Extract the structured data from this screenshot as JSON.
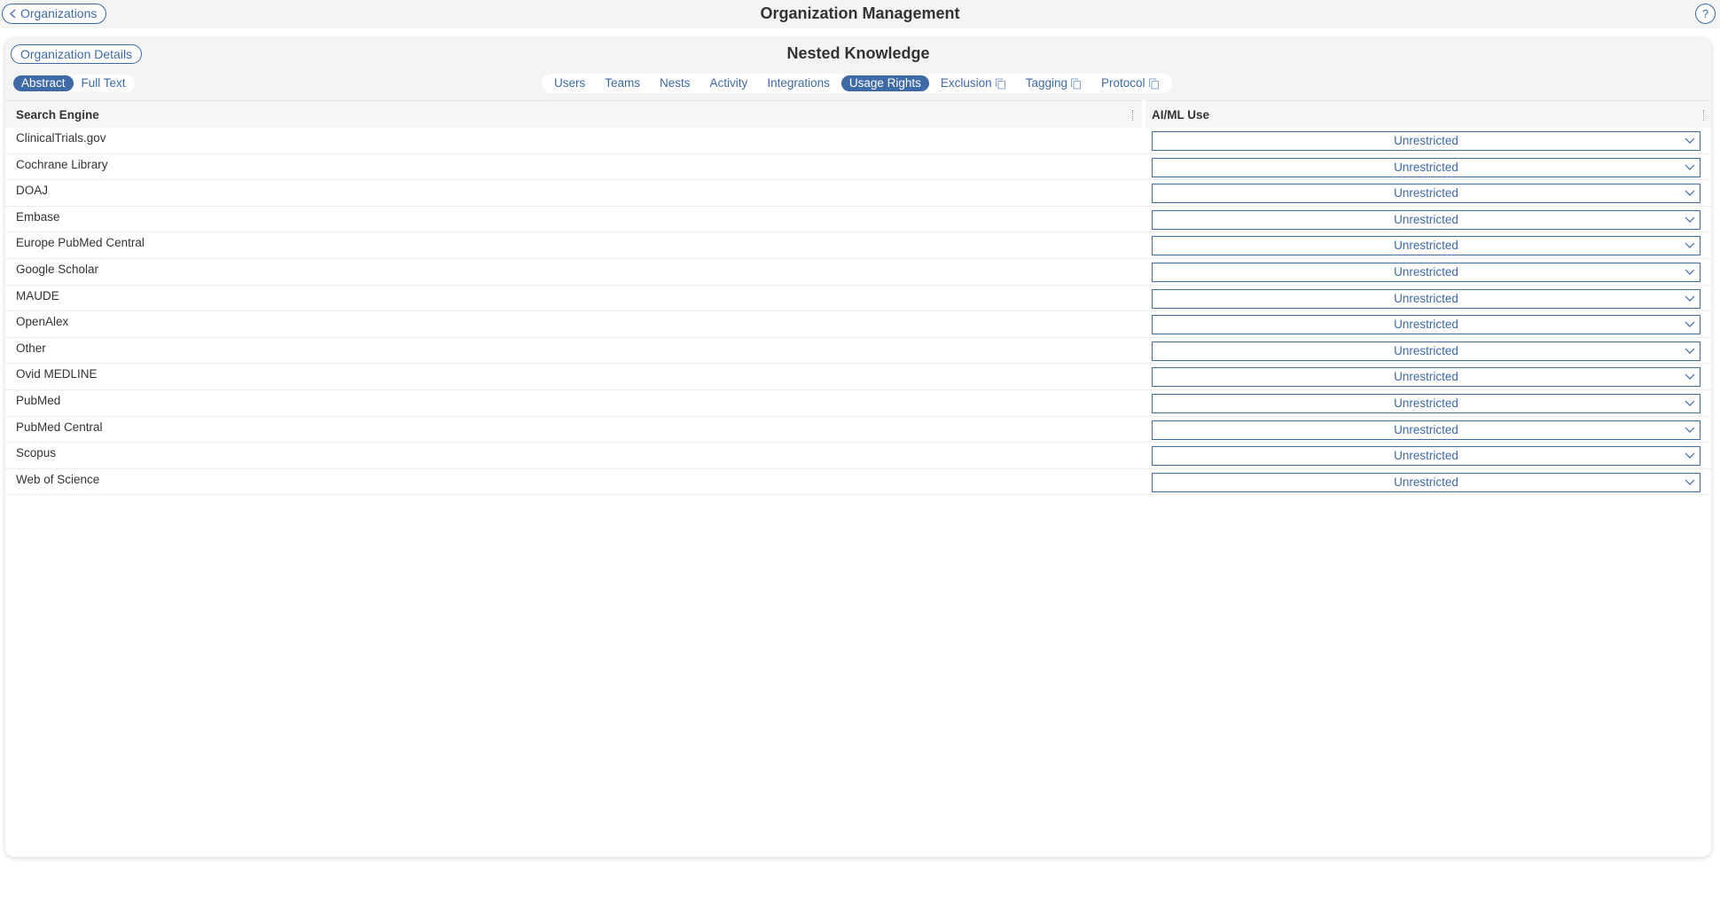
{
  "topbar": {
    "back_label": "Organizations",
    "title": "Organization Management",
    "help_label": "?"
  },
  "panel": {
    "details_button": "Organization Details",
    "title": "Nested Knowledge",
    "modes": [
      {
        "label": "Abstract",
        "active": true
      },
      {
        "label": "Full Text",
        "active": false
      }
    ],
    "tabs": [
      {
        "label": "Users",
        "active": false,
        "copy_icon": false
      },
      {
        "label": "Teams",
        "active": false,
        "copy_icon": false
      },
      {
        "label": "Nests",
        "active": false,
        "copy_icon": false
      },
      {
        "label": "Activity",
        "active": false,
        "copy_icon": false
      },
      {
        "label": "Integrations",
        "active": false,
        "copy_icon": false
      },
      {
        "label": "Usage Rights",
        "active": true,
        "copy_icon": false
      },
      {
        "label": "Exclusion",
        "active": false,
        "copy_icon": true
      },
      {
        "label": "Tagging",
        "active": false,
        "copy_icon": true
      },
      {
        "label": "Protocol",
        "active": false,
        "copy_icon": true
      }
    ]
  },
  "table": {
    "columns": [
      "Search Engine",
      "AI/ML Use"
    ],
    "rows": [
      {
        "engine": "ClinicalTrials.gov",
        "use": "Unrestricted"
      },
      {
        "engine": "Cochrane Library",
        "use": "Unrestricted"
      },
      {
        "engine": "DOAJ",
        "use": "Unrestricted"
      },
      {
        "engine": "Embase",
        "use": "Unrestricted"
      },
      {
        "engine": "Europe PubMed Central",
        "use": "Unrestricted"
      },
      {
        "engine": "Google Scholar",
        "use": "Unrestricted"
      },
      {
        "engine": "MAUDE",
        "use": "Unrestricted"
      },
      {
        "engine": "OpenAlex",
        "use": "Unrestricted"
      },
      {
        "engine": "Other",
        "use": "Unrestricted"
      },
      {
        "engine": "Ovid MEDLINE",
        "use": "Unrestricted"
      },
      {
        "engine": "PubMed",
        "use": "Unrestricted"
      },
      {
        "engine": "PubMed Central",
        "use": "Unrestricted"
      },
      {
        "engine": "Scopus",
        "use": "Unrestricted"
      },
      {
        "engine": "Web of Science",
        "use": "Unrestricted"
      }
    ]
  },
  "colors": {
    "accent": "#3e6aa6",
    "header_bg": "#f4f4f4"
  }
}
